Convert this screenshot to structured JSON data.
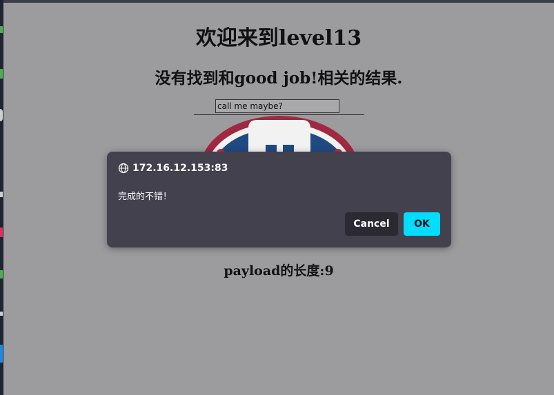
{
  "page": {
    "heading": "欢迎来到level13",
    "subheading": "没有找到和good job!相关的结果.",
    "search_value": "call me maybe?",
    "payload_length": "payload的长度:9"
  },
  "dialog": {
    "origin": "172.16.12.153:83",
    "message": "完成的不错！",
    "cancel_label": "Cancel",
    "ok_label": "OK",
    "origin_icon": "globe-icon"
  },
  "colors": {
    "page_background": "#9c9b9e",
    "dialog_background": "#42414d",
    "ok_button": "#00ddff",
    "cancel_button": "#2b2a33"
  }
}
